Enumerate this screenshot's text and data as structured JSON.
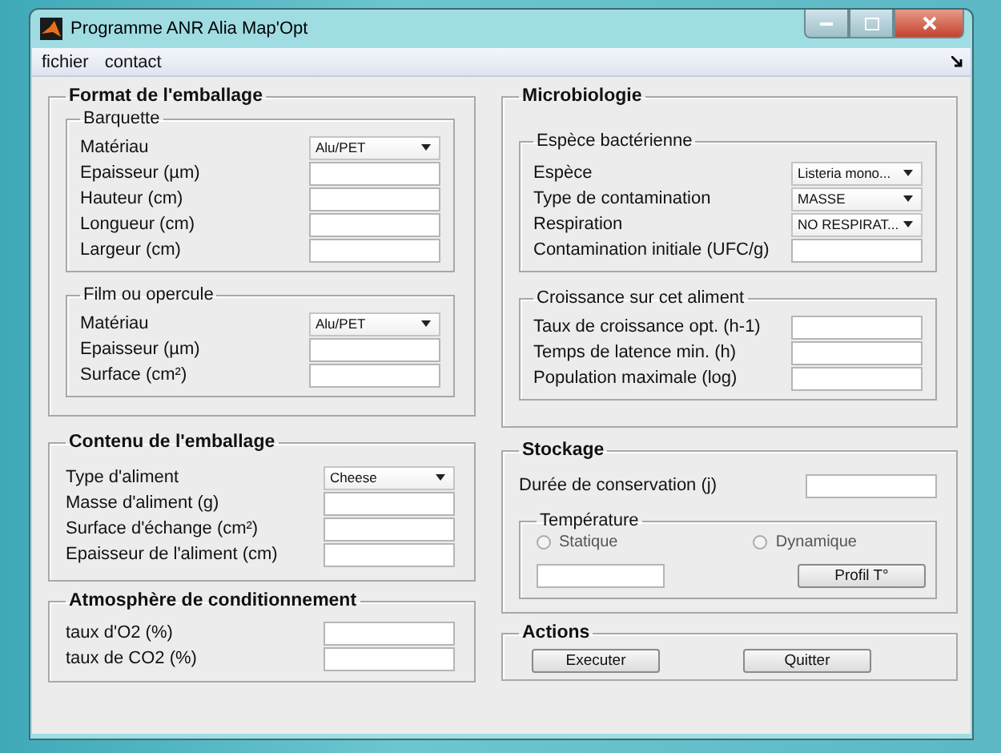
{
  "window": {
    "title": "Programme ANR Alia Map'Opt"
  },
  "menu": [
    {
      "label": "fichier"
    },
    {
      "label": "contact"
    }
  ],
  "columns": [
    {
      "panels": [
        {
          "title": "Format de l'emballage",
          "items": [
            {
              "kind": "group",
              "title": "Barquette",
              "items": [
                {
                  "kind": "select",
                  "label": "Matériau",
                  "value": "Alu/PET"
                },
                {
                  "kind": "input",
                  "label": "Epaisseur (µm)"
                },
                {
                  "kind": "input",
                  "label": "Hauteur (cm)"
                },
                {
                  "kind": "input",
                  "label": "Longueur (cm)"
                },
                {
                  "kind": "input",
                  "label": "Largeur (cm)"
                }
              ]
            },
            {
              "kind": "group",
              "title": "Film ou opercule",
              "items": [
                {
                  "kind": "select",
                  "label": "Matériau",
                  "value": "Alu/PET"
                },
                {
                  "kind": "input",
                  "label": "Epaisseur (µm)"
                },
                {
                  "kind": "input",
                  "label": "Surface (cm²)"
                }
              ]
            }
          ]
        },
        {
          "title": "Contenu de l'emballage",
          "items": [
            {
              "kind": "select",
              "label": "Type d'aliment",
              "value": "Cheese"
            },
            {
              "kind": "input",
              "label": "Masse d'aliment (g)"
            },
            {
              "kind": "input",
              "label": "Surface d'échange (cm²)"
            },
            {
              "kind": "input",
              "label": "Epaisseur de l'aliment (cm)"
            }
          ]
        },
        {
          "title": "Atmosphère de conditionnement",
          "items": [
            {
              "kind": "input",
              "label": "taux d'O2 (%)"
            },
            {
              "kind": "input",
              "label": "taux de CO2 (%)"
            }
          ]
        }
      ]
    },
    {
      "panels": [
        {
          "title": "Microbiologie",
          "items": [
            {
              "kind": "group",
              "title": "Espèce bactérienne",
              "items": [
                {
                  "kind": "select",
                  "label": "Espèce",
                  "value": "Listeria mono..."
                },
                {
                  "kind": "select",
                  "label": "Type de contamination",
                  "value": "MASSE"
                },
                {
                  "kind": "select",
                  "label": "Respiration",
                  "value": "NO RESPIRAT..."
                },
                {
                  "kind": "input",
                  "label": "Contamination initiale (UFC/g)"
                }
              ]
            },
            {
              "kind": "group",
              "title": "Croissance sur cet aliment",
              "items": [
                {
                  "kind": "input",
                  "label": "Taux de croissance opt. (h-1)"
                },
                {
                  "kind": "input",
                  "label": "Temps de latence min. (h)"
                },
                {
                  "kind": "input",
                  "label": "Population maximale (log)"
                }
              ]
            }
          ]
        },
        {
          "title": "Stockage",
          "items": [
            {
              "kind": "input",
              "label": "Durée de conservation (j)"
            },
            {
              "kind": "group",
              "title": "Température",
              "items": [
                {
                  "kind": "radios",
                  "options": [
                    {
                      "label": "Statique",
                      "selected": false
                    },
                    {
                      "label": "Dynamique",
                      "selected": false
                    }
                  ]
                },
                {
                  "kind": "field-button",
                  "button": "Profil T°"
                }
              ]
            }
          ]
        },
        {
          "title": "Actions",
          "items": [
            {
              "kind": "buttons",
              "buttons": [
                "Executer",
                "Quitter"
              ]
            }
          ]
        }
      ]
    }
  ]
}
